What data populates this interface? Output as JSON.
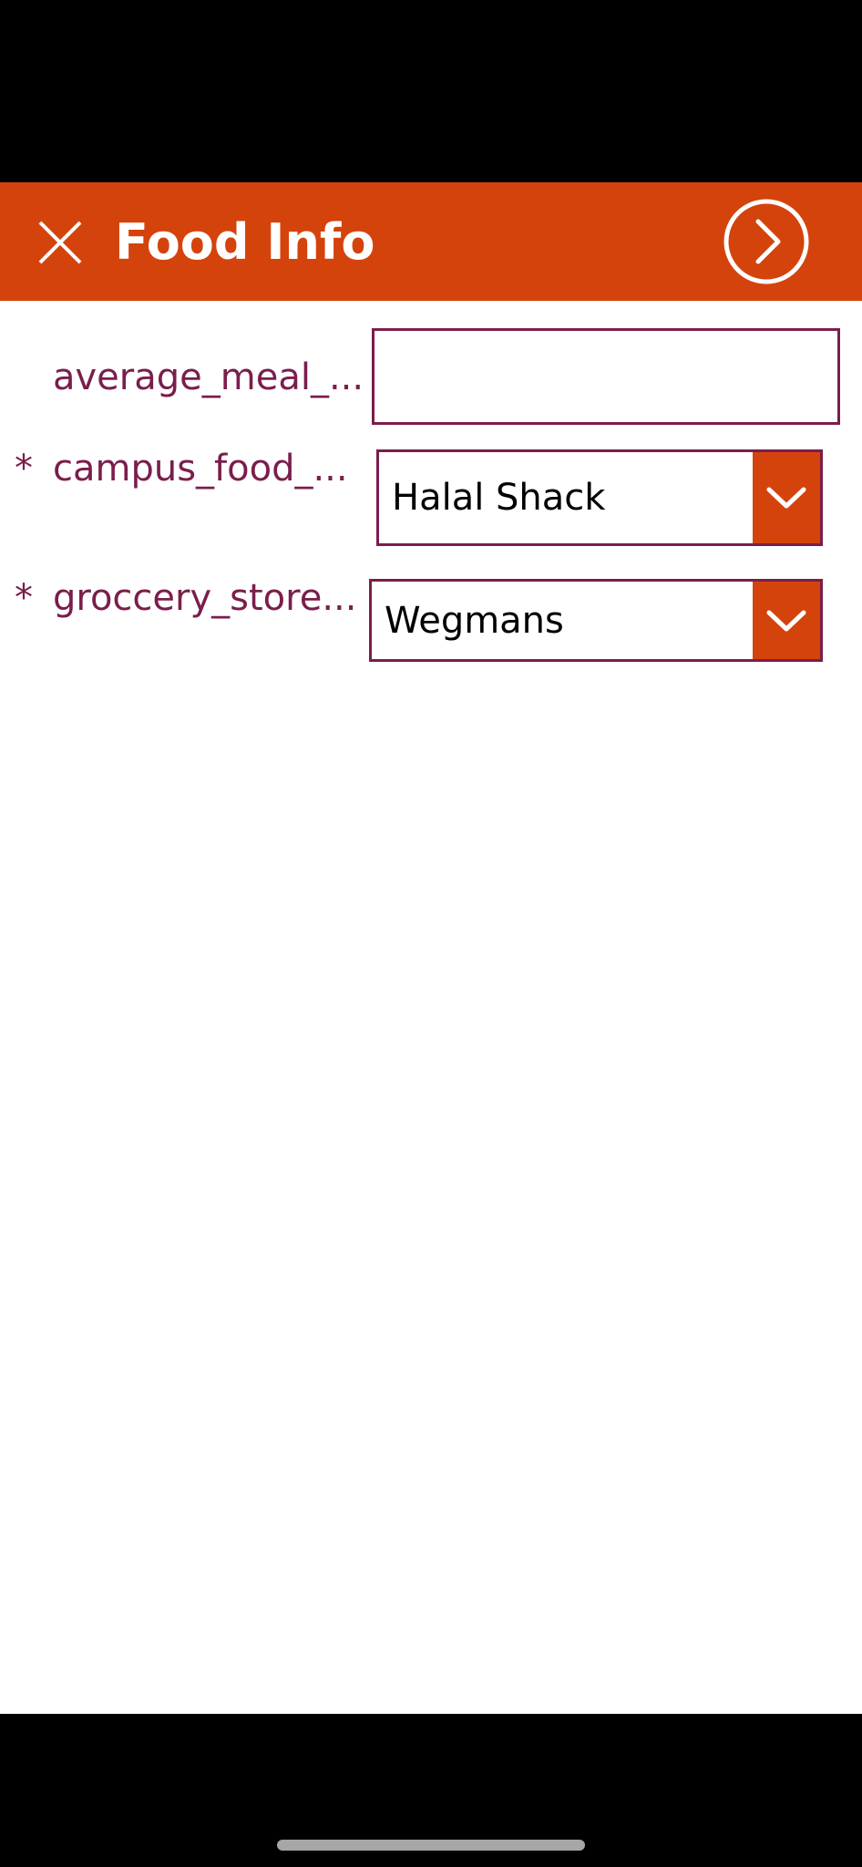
{
  "header": {
    "title": "Food Info",
    "close_icon": "close-icon",
    "next_icon": "chevron-right-circle-icon",
    "background_color": "#D4430C"
  },
  "form": {
    "fields": [
      {
        "label": "average_meal_...",
        "required": false,
        "type": "text",
        "value": ""
      },
      {
        "label": "campus_food_...",
        "required": true,
        "required_marker": "*",
        "type": "dropdown",
        "value": "Halal Shack"
      },
      {
        "label": "groccery_store...",
        "required": true,
        "required_marker": "*",
        "type": "dropdown",
        "value": "Wegmans"
      }
    ],
    "label_color": "#7A1E4C",
    "border_color": "#7A1E4C",
    "dropdown_icon": "chevron-down-icon"
  }
}
